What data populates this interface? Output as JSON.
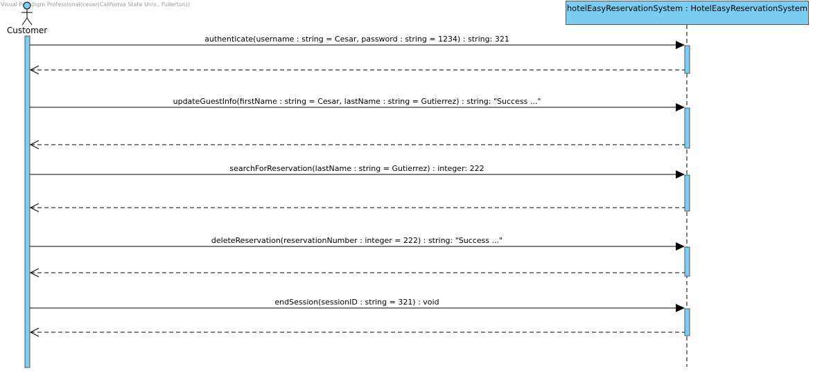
{
  "watermark": "Visual Paradigm Professional(cesar(California State Univ., Fullerton))",
  "actor": {
    "name": "Customer"
  },
  "system": {
    "name": "hotelEasyReservationSystem : HotelEasyReservationSystem"
  },
  "colors": {
    "activation": "#7dcdf3",
    "line": "#000000"
  },
  "messages": [
    {
      "label": "authenticate(username : string = Cesar, password : string = 1234) : string: 321"
    },
    {
      "label": "updateGuestInfo(firstName : string = Cesar, lastName : string = Gutierrez) : string: \"Success ...\""
    },
    {
      "label": "searchForReservation(lastName : string = Gutierrez) : integer: 222"
    },
    {
      "label": "deleteReservation(reservationNumber : integer = 222) : string: \"Success ...\""
    },
    {
      "label": "endSession(sessionID : string = 321) : void"
    }
  ]
}
